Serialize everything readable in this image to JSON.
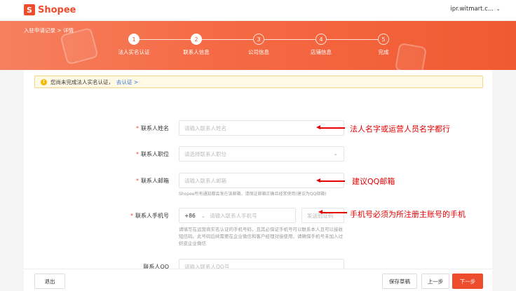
{
  "header": {
    "logo_text": "Shopee",
    "account": "ipr.witmart.c...",
    "chevron": "⌄"
  },
  "banner": {
    "breadcrumb": "入驻申请记录 > 详情"
  },
  "steps": [
    {
      "num": "1",
      "label": "法人实名认证"
    },
    {
      "num": "2",
      "label": "联系人信息"
    },
    {
      "num": "3",
      "label": "公司信息"
    },
    {
      "num": "4",
      "label": "店铺信息"
    },
    {
      "num": "5",
      "label": "完成"
    }
  ],
  "notice": {
    "icon": "!",
    "text": "您尚未完成法人实名认证，",
    "link": "去认证 >"
  },
  "form": {
    "name": {
      "label": "联系人姓名",
      "placeholder": "请输入联系人姓名"
    },
    "position": {
      "label": "联系人职位",
      "placeholder": "请选择联系人职位"
    },
    "email": {
      "label": "联系人邮箱",
      "placeholder": "请输入联系人邮箱",
      "hint": "Shopee所有通知都会发在该邮箱，请保证邮箱正确且经常使用(建议为QQ邮箱)"
    },
    "phone": {
      "label": "联系人手机号",
      "code": "+86",
      "placeholder": "请输入联系人手机号",
      "sms_placeholder": "发送验证码",
      "hint": "请填写在运营商实名认证的手机号码，且其必保证手机号可以联系本人且可以接收短信码。此号码后续需要在企业微信和客户经理对接使用，请确保手机号未加入过虾皮企业微信"
    },
    "qq": {
      "label": "联系人QQ",
      "placeholder": "请输入联系人QQ号"
    },
    "required_mark": "*"
  },
  "annotations": {
    "name": "法人名字或运营人员名字都行",
    "email": "建议QQ邮箱",
    "phone": "手机号必须为所注册主账号的手机"
  },
  "footer": {
    "exit": "退出",
    "save": "保存草稿",
    "prev": "上一步",
    "next": "下一步"
  },
  "colors": {
    "brand": "#ee4d2d",
    "annotation": "#e60000"
  }
}
